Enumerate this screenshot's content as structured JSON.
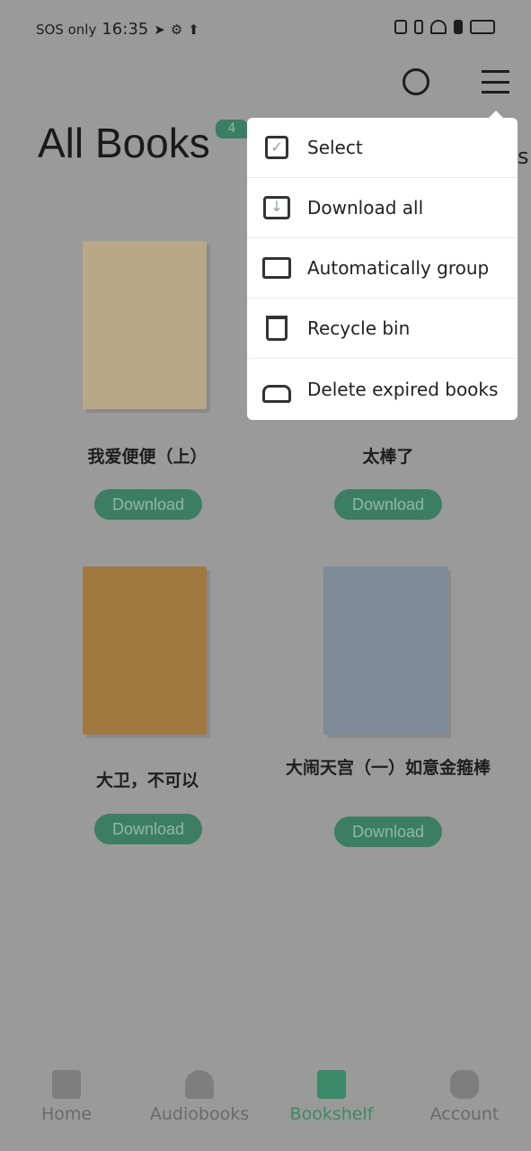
{
  "status_bar": {
    "carrier": "SOS only",
    "time": "16:35"
  },
  "header": {
    "title": "All Books",
    "count_badge": "4"
  },
  "menu": {
    "items": [
      {
        "label": "Select",
        "icon": "select-icon"
      },
      {
        "label": "Download all",
        "icon": "download-icon"
      },
      {
        "label": "Automatically group",
        "icon": "folder-icon"
      },
      {
        "label": "Recycle bin",
        "icon": "trash-icon"
      },
      {
        "label": "Delete expired books",
        "icon": "broom-icon"
      }
    ]
  },
  "books": [
    {
      "title": "我爱便便（上）",
      "button": "Download",
      "cover_color": "#b8a888"
    },
    {
      "title": "太棒了",
      "button": "Download",
      "cover_color": "#8a9a88"
    },
    {
      "title": "大卫，不可以",
      "button": "Download",
      "cover_color": "#a07840"
    },
    {
      "title": "大闹天宫（一）如意金箍棒",
      "button": "Download",
      "cover_color": "#7f8a98"
    }
  ],
  "nav": {
    "items": [
      {
        "label": "Home"
      },
      {
        "label": "Audiobooks"
      },
      {
        "label": "Bookshelf",
        "active": true
      },
      {
        "label": "Account"
      }
    ]
  },
  "colors": {
    "accent": "#3a8a6a",
    "overlay": "#9a9a9a"
  }
}
